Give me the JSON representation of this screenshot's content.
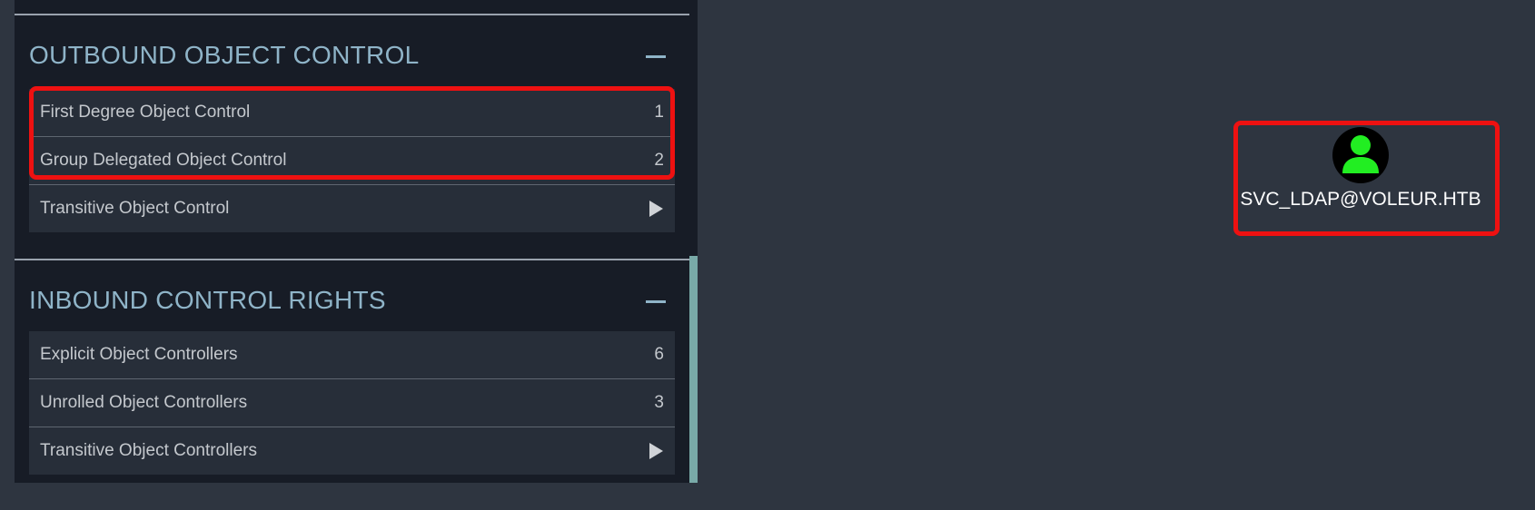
{
  "outbound": {
    "title": "OUTBOUND OBJECT CONTROL",
    "rows": [
      {
        "label": "First Degree Object Control",
        "count": "1"
      },
      {
        "label": "Group Delegated Object Control",
        "count": "2"
      },
      {
        "label": "Transitive Object Control",
        "icon": "play-arrow-icon"
      }
    ]
  },
  "inbound": {
    "title": "INBOUND CONTROL RIGHTS",
    "rows": [
      {
        "label": "Explicit Object Controllers",
        "count": "6"
      },
      {
        "label": "Unrolled Object Controllers",
        "count": "3"
      },
      {
        "label": "Transitive Object Controllers",
        "icon": "play-arrow-icon"
      }
    ]
  },
  "graph": {
    "node": {
      "label": "SVC_LDAP@VOLEUR.HTB",
      "icon": "user-icon",
      "icon_color": "#22ee22"
    }
  },
  "colors": {
    "background": "#2e3540",
    "panel": "#171c26",
    "row": "#272e39",
    "section_title": "#8fb4c8",
    "highlight": "#ee1111",
    "scrollbar": "#79aaa8"
  }
}
